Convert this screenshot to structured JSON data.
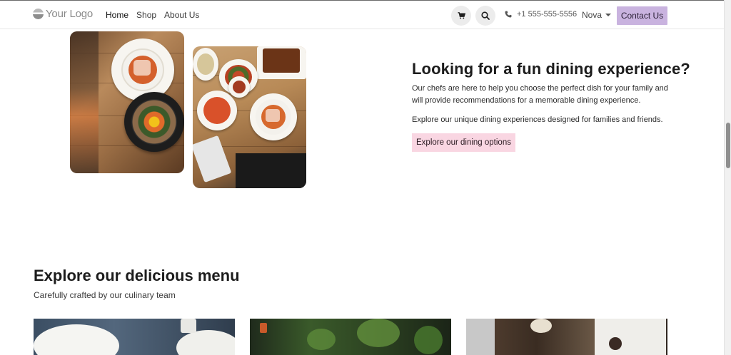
{
  "header": {
    "logo_text": "Your Logo",
    "nav": [
      {
        "label": "Home",
        "active": true
      },
      {
        "label": "Shop",
        "active": false
      },
      {
        "label": "About Us",
        "active": false
      }
    ],
    "cart_icon": "cart-icon",
    "search_icon": "search-icon",
    "phone": "+1 555-555-5556",
    "user_name": "Nova",
    "contact_label": "Contact Us",
    "contact_color": "#c9b3df"
  },
  "hero": {
    "title": "Looking for a fun dining experience?",
    "paragraph1": "Our chefs are here to help you choose the perfect dish for your family and will provide recommendations for a memorable dining experience.",
    "paragraph2": "Explore our unique dining experiences designed for families and friends.",
    "button_label": "Explore our dining options",
    "button_color": "#f9d6e2"
  },
  "menu": {
    "title": "Explore our delicious menu",
    "subtitle": "Carefully crafted by our culinary team"
  }
}
